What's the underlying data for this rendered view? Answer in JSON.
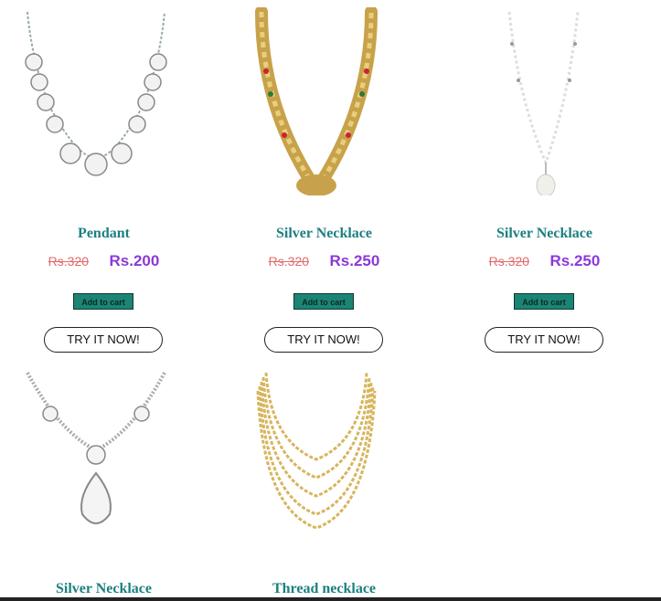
{
  "products": [
    {
      "name": "Pendant",
      "old_price": "Rs.320",
      "price": "Rs.200",
      "cart_label": "Add to cart",
      "try_label": "TRY IT NOW!",
      "image": "silver-coin-necklace-image"
    },
    {
      "name": "Silver Necklace",
      "old_price": "Rs.320",
      "price": "Rs.250",
      "cart_label": "Add to cart",
      "try_label": "TRY IT NOW!",
      "image": "gold-leaf-necklace-image"
    },
    {
      "name": "Silver Necklace",
      "old_price": "Rs.320",
      "price": "Rs.250",
      "cart_label": "Add to cart",
      "try_label": "TRY IT NOW!",
      "image": "pearl-chain-necklace-image"
    },
    {
      "name": "Silver Necklace",
      "image": "diamond-drop-necklace-image"
    },
    {
      "name": "Thread necklace",
      "image": "gold-multistrand-necklace-image"
    }
  ],
  "colors": {
    "title": "#1c7f80",
    "old_price": "#e26a6a",
    "price": "#8b39d8",
    "cart_button": "#1c8474"
  }
}
